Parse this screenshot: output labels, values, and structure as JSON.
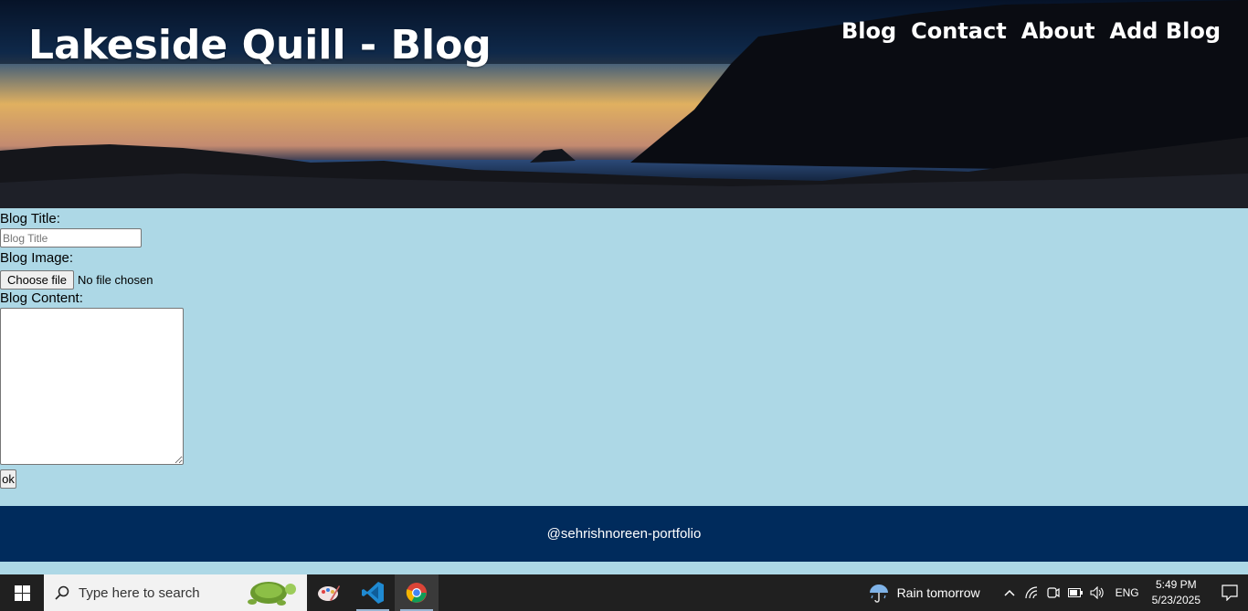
{
  "header": {
    "title": "Lakeside Quill - Blog",
    "nav": [
      "Blog",
      "Contact",
      "About",
      "Add Blog"
    ]
  },
  "form": {
    "title_label": "Blog Title:",
    "title_placeholder": "Blog Title",
    "image_label": "Blog Image:",
    "file_button": "Choose file",
    "file_status": "No file chosen",
    "content_label": "Blog Content:",
    "submit_label": "ok"
  },
  "footer": {
    "text": "@sehrishnoreen-portfolio"
  },
  "taskbar": {
    "search_placeholder": "Type here to search",
    "apps": [
      "paint-icon",
      "vscode-icon",
      "chrome-icon"
    ],
    "weather": "Rain tomorrow",
    "language": "ENG",
    "time": "5:49 PM",
    "date": "5/23/2025"
  },
  "colors": {
    "page_bg": "#add8e6",
    "footer_bg": "#002b5c",
    "taskbar_bg": "#202020"
  }
}
